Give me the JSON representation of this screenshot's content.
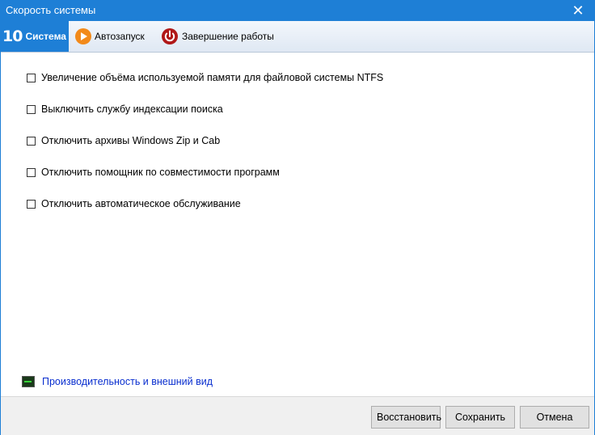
{
  "window": {
    "title": "Скорость системы"
  },
  "tabs": [
    {
      "icon_text": "10",
      "label": "Система",
      "active": true
    },
    {
      "label": "Автозапуск"
    },
    {
      "label": "Завершение работы"
    }
  ],
  "options": [
    {
      "label": "Увеличение объёма используемой памяти для файловой системы NTFS",
      "checked": false
    },
    {
      "label": "Выключить службу индексации поиска",
      "checked": false
    },
    {
      "label": "Отключить архивы Windows Zip и Cab",
      "checked": false
    },
    {
      "label": "Отключить помощник по совместимости программ",
      "checked": false
    },
    {
      "label": "Отключить автоматическое обслуживание",
      "checked": false
    }
  ],
  "footer_link": {
    "label": "Производительность и внешний вид"
  },
  "buttons": {
    "restore": "Восстановить",
    "save": "Сохранить",
    "cancel": "Отмена"
  },
  "colors": {
    "accent": "#1e7fd6",
    "link": "#0a2fcf",
    "autorun_icon": "#f28a1a",
    "shutdown_icon": "#b01818"
  }
}
